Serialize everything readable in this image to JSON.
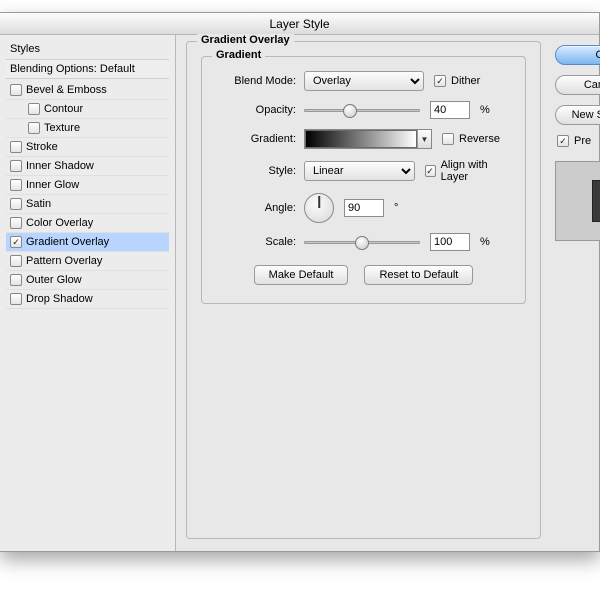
{
  "window": {
    "title": "Layer Style"
  },
  "styles": {
    "header": "Styles",
    "sub": "Blending Options: Default",
    "items": [
      {
        "label": "Bevel & Emboss",
        "checked": false,
        "selected": false
      },
      {
        "label": "Contour",
        "checked": false,
        "selected": false,
        "indent": true
      },
      {
        "label": "Texture",
        "checked": false,
        "selected": false,
        "indent": true
      },
      {
        "label": "Stroke",
        "checked": false,
        "selected": false
      },
      {
        "label": "Inner Shadow",
        "checked": false,
        "selected": false
      },
      {
        "label": "Inner Glow",
        "checked": false,
        "selected": false
      },
      {
        "label": "Satin",
        "checked": false,
        "selected": false
      },
      {
        "label": "Color Overlay",
        "checked": false,
        "selected": false
      },
      {
        "label": "Gradient Overlay",
        "checked": true,
        "selected": true
      },
      {
        "label": "Pattern Overlay",
        "checked": false,
        "selected": false
      },
      {
        "label": "Outer Glow",
        "checked": false,
        "selected": false
      },
      {
        "label": "Drop Shadow",
        "checked": false,
        "selected": false
      }
    ]
  },
  "panel": {
    "title": "Gradient Overlay",
    "subtitle": "Gradient",
    "labels": {
      "blend": "Blend Mode:",
      "opacity": "Opacity:",
      "gradient": "Gradient:",
      "style": "Style:",
      "angle": "Angle:",
      "scale": "Scale:"
    },
    "blend_mode": "Overlay",
    "dither": {
      "label": "Dither",
      "checked": true
    },
    "opacity": {
      "value": "40",
      "unit": "%",
      "slider_pct": 40
    },
    "reverse": {
      "label": "Reverse",
      "checked": false
    },
    "style_value": "Linear",
    "align": {
      "label": "Align with Layer",
      "checked": true
    },
    "angle": {
      "value": "90",
      "unit": "°"
    },
    "scale": {
      "value": "100",
      "unit": "%",
      "slider_pct": 50
    },
    "buttons": {
      "make_default": "Make Default",
      "reset": "Reset to Default"
    }
  },
  "right": {
    "ok": "O",
    "cancel": "Can",
    "new_style": "New S",
    "preview": {
      "label": "Pre",
      "checked": true
    }
  }
}
